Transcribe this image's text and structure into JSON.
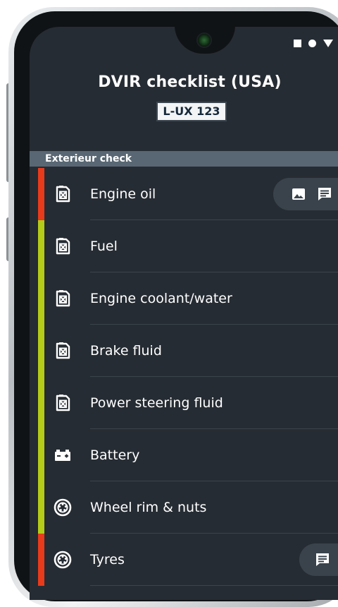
{
  "header": {
    "title": "DVIR checklist (USA)",
    "plate": "L-UX 123"
  },
  "section": {
    "title": "Exterieur check"
  },
  "colors": {
    "red": "#e83b1c",
    "green": "#b5cc18",
    "background": "#262c33",
    "section": "#586773"
  },
  "items": [
    {
      "label": "Engine oil",
      "icon": "fuel-can-icon",
      "status": "red",
      "actions": [
        "image-icon",
        "comment-icon",
        "status-dot"
      ]
    },
    {
      "label": "Fuel",
      "icon": "fuel-can-icon",
      "status": "green"
    },
    {
      "label": "Engine coolant/water",
      "icon": "fuel-can-icon",
      "status": "green"
    },
    {
      "label": "Brake fluid",
      "icon": "fuel-can-icon",
      "status": "green"
    },
    {
      "label": "Power steering fluid",
      "icon": "fuel-can-icon",
      "status": "green"
    },
    {
      "label": "Battery",
      "icon": "battery-icon",
      "status": "green"
    },
    {
      "label": "Wheel rim & nuts",
      "icon": "wheel-icon",
      "status": "green"
    },
    {
      "label": "Tyres",
      "icon": "wheel-icon",
      "status": "red",
      "actions": [
        "comment-icon"
      ]
    }
  ]
}
